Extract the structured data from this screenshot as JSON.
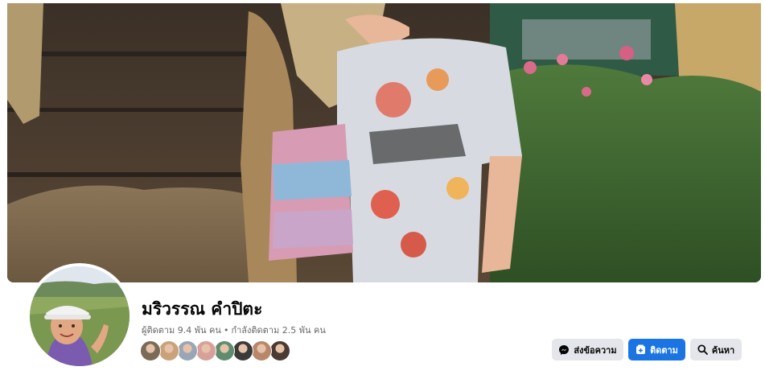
{
  "profile": {
    "name": "มริวรรณ คำปิตะ",
    "followers": "ผู้ติดตาม 9.4 พัน คน",
    "following": "กำลังติดตาม 2.5 พัน คน",
    "separator": "•"
  },
  "friends_preview": [
    {
      "name": "friend-1",
      "color": "#7b6a58"
    },
    {
      "name": "friend-2",
      "color": "#c9a27a"
    },
    {
      "name": "friend-3",
      "color": "#9aa5b5"
    },
    {
      "name": "friend-4",
      "color": "#d8a09a"
    },
    {
      "name": "friend-5",
      "color": "#5f8c6e"
    },
    {
      "name": "friend-6",
      "color": "#3a3a3a"
    },
    {
      "name": "friend-7",
      "color": "#b8876a"
    },
    {
      "name": "friend-8",
      "color": "#4b3a33"
    }
  ],
  "actions": {
    "message_label": "ส่งข้อความ",
    "follow_label": "ติดตาม",
    "search_label": "ค้นหา"
  },
  "colors": {
    "primary": "#1b74e4",
    "secondary_button": "#e4e6eb",
    "text": "#050505",
    "muted_text": "#65676b"
  },
  "icons": {
    "message": "messenger-icon",
    "follow": "follow-icon",
    "search": "search-icon"
  }
}
